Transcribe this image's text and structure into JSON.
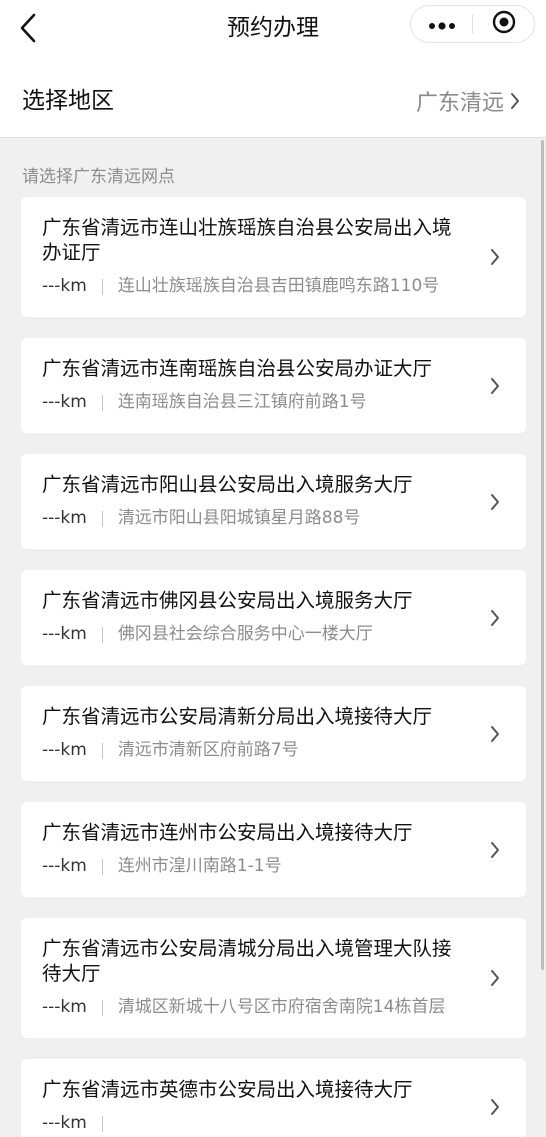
{
  "navbar": {
    "title": "预约办理",
    "back_icon": "back-chevron-icon",
    "more_icon": "more-dots-icon",
    "close_icon": "mini-program-close-icon"
  },
  "region": {
    "label": "选择地区",
    "value": "广东清远"
  },
  "list": {
    "hint": "请选择广东清远网点",
    "offices": [
      {
        "name": "广东省清远市连山壮族瑶族自治县公安局出入境办证厅",
        "distance": "---km",
        "address": "连山壮族瑶族自治县吉田镇鹿鸣东路110号"
      },
      {
        "name": "广东省清远市连南瑶族自治县公安局办证大厅",
        "distance": "---km",
        "address": "连南瑶族自治县三江镇府前路1号"
      },
      {
        "name": "广东省清远市阳山县公安局出入境服务大厅",
        "distance": "---km",
        "address": "清远市阳山县阳城镇星月路88号"
      },
      {
        "name": "广东省清远市佛冈县公安局出入境服务大厅",
        "distance": "---km",
        "address": "佛冈县社会综合服务中心一楼大厅"
      },
      {
        "name": "广东省清远市公安局清新分局出入境接待大厅",
        "distance": "---km",
        "address": "清远市清新区府前路7号"
      },
      {
        "name": "广东省清远市连州市公安局出入境接待大厅",
        "distance": "---km",
        "address": "连州市湟川南路1-1号"
      },
      {
        "name": "广东省清远市公安局清城分局出入境管理大队接待大厅",
        "distance": "---km",
        "address": "清城区新城十八号区市府宿舍南院14栋首层"
      },
      {
        "name": "广东省清远市英德市公安局出入境接待大厅",
        "distance": "---km",
        "address": ""
      }
    ]
  },
  "colors": {
    "background": "#f0f0f0",
    "card": "#ffffff",
    "secondary_text": "#8c8c8c"
  }
}
